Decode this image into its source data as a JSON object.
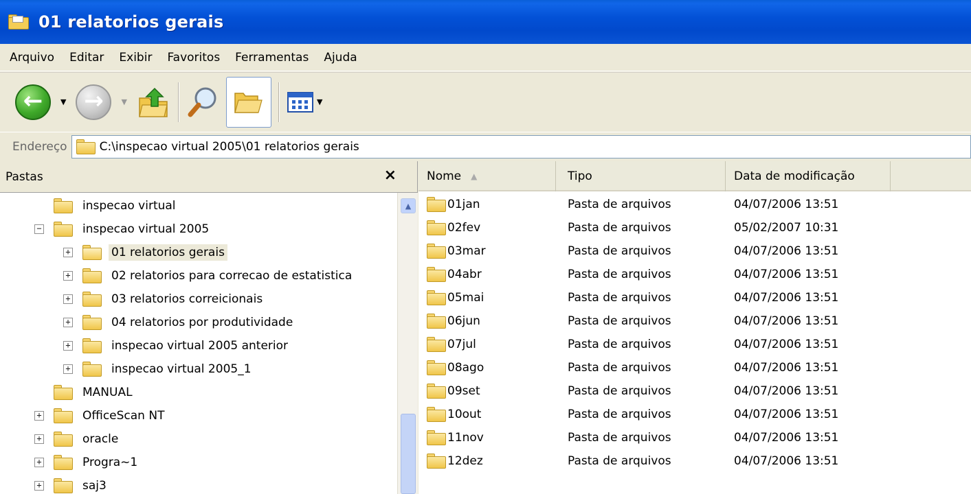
{
  "window": {
    "title": "01 relatorios gerais"
  },
  "menu": [
    "Arquivo",
    "Editar",
    "Exibir",
    "Favoritos",
    "Ferramentas",
    "Ajuda"
  ],
  "toolbar": {
    "buttons": [
      "back-button",
      "forward-button",
      "up-folder-button",
      "search-button",
      "folders-button",
      "views-button"
    ]
  },
  "address": {
    "label": "Endereço",
    "path": "C:\\inspecao virtual 2005\\01 relatorios gerais"
  },
  "folders_pane": {
    "title": "Pastas",
    "close": "×",
    "tree": [
      {
        "label": "inspecao virtual",
        "indent": 0,
        "expander": ""
      },
      {
        "label": "inspecao virtual 2005",
        "indent": 0,
        "expander": "−"
      },
      {
        "label": "01 relatorios gerais",
        "indent": 1,
        "expander": "+",
        "selected": true
      },
      {
        "label": "02 relatorios para correcao de estatistica",
        "indent": 1,
        "expander": "+"
      },
      {
        "label": "03 relatorios correicionais",
        "indent": 1,
        "expander": "+"
      },
      {
        "label": "04 relatorios por produtividade",
        "indent": 1,
        "expander": "+"
      },
      {
        "label": "inspecao virtual 2005 anterior",
        "indent": 1,
        "expander": "+"
      },
      {
        "label": "inspecao virtual 2005_1",
        "indent": 1,
        "expander": "+"
      },
      {
        "label": "MANUAL",
        "indent": 0,
        "expander": ""
      },
      {
        "label": "OfficeScan NT",
        "indent": 0,
        "expander": "+"
      },
      {
        "label": "oracle",
        "indent": 0,
        "expander": "+"
      },
      {
        "label": "Progra~1",
        "indent": 0,
        "expander": "+"
      },
      {
        "label": "saj3",
        "indent": 0,
        "expander": "+"
      }
    ]
  },
  "file_list": {
    "columns": {
      "name": "Nome",
      "type": "Tipo",
      "date": "Data de modificação"
    },
    "rows": [
      {
        "name": "01jan",
        "type": "Pasta de arquivos",
        "date": "04/07/2006 13:51"
      },
      {
        "name": "02fev",
        "type": "Pasta de arquivos",
        "date": "05/02/2007 10:31"
      },
      {
        "name": "03mar",
        "type": "Pasta de arquivos",
        "date": "04/07/2006 13:51"
      },
      {
        "name": "04abr",
        "type": "Pasta de arquivos",
        "date": "04/07/2006 13:51"
      },
      {
        "name": "05mai",
        "type": "Pasta de arquivos",
        "date": "04/07/2006 13:51"
      },
      {
        "name": "06jun",
        "type": "Pasta de arquivos",
        "date": "04/07/2006 13:51"
      },
      {
        "name": "07jul",
        "type": "Pasta de arquivos",
        "date": "04/07/2006 13:51"
      },
      {
        "name": "08ago",
        "type": "Pasta de arquivos",
        "date": "04/07/2006 13:51"
      },
      {
        "name": "09set",
        "type": "Pasta de arquivos",
        "date": "04/07/2006 13:51"
      },
      {
        "name": "10out",
        "type": "Pasta de arquivos",
        "date": "04/07/2006 13:51"
      },
      {
        "name": "11nov",
        "type": "Pasta de arquivos",
        "date": "04/07/2006 13:51"
      },
      {
        "name": "12dez",
        "type": "Pasta de arquivos",
        "date": "04/07/2006 13:51"
      }
    ]
  }
}
